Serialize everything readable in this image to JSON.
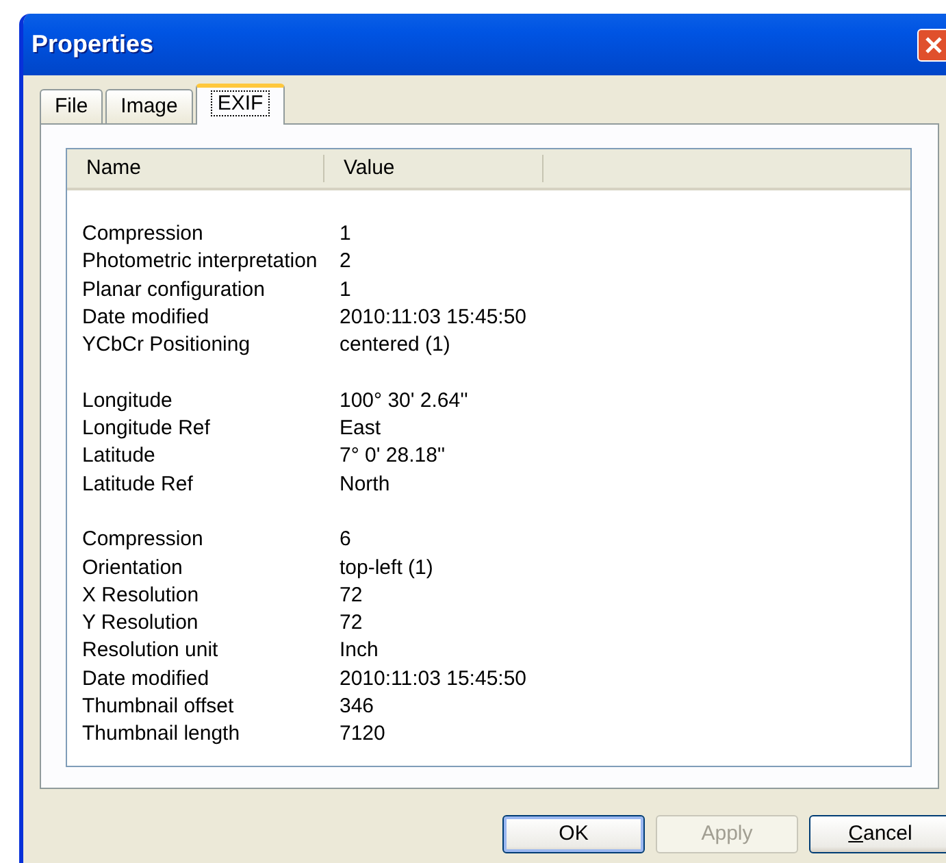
{
  "window": {
    "title": "Properties"
  },
  "tabs": [
    {
      "label": "File",
      "selected": false
    },
    {
      "label": "Image",
      "selected": false
    },
    {
      "label": "EXIF",
      "selected": true
    }
  ],
  "table": {
    "columns": [
      "Name",
      "Value"
    ],
    "groups": [
      [
        {
          "name": "Compression",
          "value": "1"
        },
        {
          "name": "Photometric interpretation",
          "value": "2"
        },
        {
          "name": "Planar configuration",
          "value": "1"
        },
        {
          "name": "Date modified",
          "value": "2010:11:03 15:45:50"
        },
        {
          "name": "YCbCr Positioning",
          "value": "centered (1)"
        }
      ],
      [
        {
          "name": "Longitude",
          "value": "100° 30' 2.64''"
        },
        {
          "name": "Longitude Ref",
          "value": "East"
        },
        {
          "name": "Latitude",
          "value": "7° 0' 28.18''"
        },
        {
          "name": "Latitude Ref",
          "value": "North"
        }
      ],
      [
        {
          "name": "Compression",
          "value": "6"
        },
        {
          "name": "Orientation",
          "value": "top-left (1)"
        },
        {
          "name": "X Resolution",
          "value": "72"
        },
        {
          "name": "Y Resolution",
          "value": "72"
        },
        {
          "name": "Resolution unit",
          "value": "Inch"
        },
        {
          "name": "Date modified",
          "value": "2010:11:03 15:45:50"
        },
        {
          "name": "Thumbnail offset",
          "value": "346"
        },
        {
          "name": "Thumbnail length",
          "value": "7120"
        }
      ]
    ]
  },
  "buttons": [
    {
      "label": "OK",
      "default": true,
      "disabled": false,
      "access_key_underlined": false
    },
    {
      "label": "Apply",
      "default": false,
      "disabled": true,
      "access_key_underlined": false
    },
    {
      "label": "Cancel",
      "default": false,
      "disabled": false,
      "access_key_underlined": true
    }
  ]
}
